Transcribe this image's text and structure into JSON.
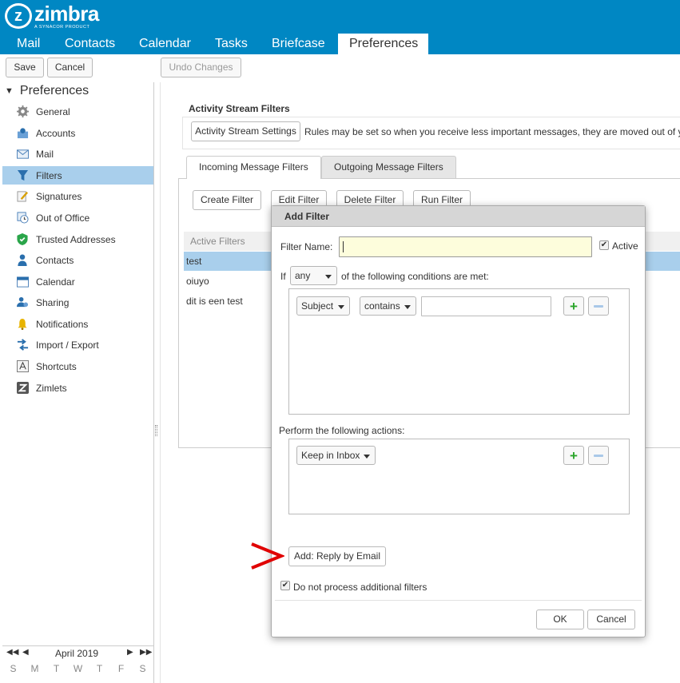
{
  "header": {
    "brand": "zimbra",
    "brand_sub": "A SYNACOR PRODUCT",
    "tabs": [
      "Mail",
      "Contacts",
      "Calendar",
      "Tasks",
      "Briefcase",
      "Preferences"
    ],
    "active_tab": "Preferences",
    "colors": {
      "topbar": "#0087c3",
      "selected": "#a9cfec"
    }
  },
  "toolbar": {
    "save": "Save",
    "cancel": "Cancel",
    "undo": "Undo Changes"
  },
  "sidebar": {
    "title": "Preferences",
    "items": [
      {
        "label": "General",
        "icon": "gear-icon"
      },
      {
        "label": "Accounts",
        "icon": "accounts-icon"
      },
      {
        "label": "Mail",
        "icon": "envelope-icon"
      },
      {
        "label": "Filters",
        "icon": "filter-icon",
        "selected": true
      },
      {
        "label": "Signatures",
        "icon": "signature-icon"
      },
      {
        "label": "Out of Office",
        "icon": "clock-icon"
      },
      {
        "label": "Trusted Addresses",
        "icon": "shield-icon"
      },
      {
        "label": "Contacts",
        "icon": "person-icon"
      },
      {
        "label": "Calendar",
        "icon": "calendar-icon"
      },
      {
        "label": "Sharing",
        "icon": "sharing-icon"
      },
      {
        "label": "Notifications",
        "icon": "bell-icon"
      },
      {
        "label": "Import / Export",
        "icon": "import-export-icon"
      },
      {
        "label": "Shortcuts",
        "icon": "keyboard-icon"
      },
      {
        "label": "Zimlets",
        "icon": "zimlet-icon"
      }
    ],
    "calendar": {
      "month": "April 2019",
      "days": [
        "S",
        "M",
        "T",
        "W",
        "T",
        "F",
        "S"
      ]
    }
  },
  "main": {
    "activity_stream": {
      "title": "Activity Stream Filters",
      "settings_button": "Activity Stream Settings",
      "description": "Rules may be set so when you receive less important messages, they are moved out of y"
    },
    "tabs": [
      "Incoming Message Filters",
      "Outgoing Message Filters"
    ],
    "actions": [
      "Create Filter",
      "Edit Filter",
      "Delete Filter",
      "Run Filter"
    ],
    "list_header": "Active Filters",
    "filters": [
      "test",
      "oiuyo",
      "dit is een test"
    ]
  },
  "dialog": {
    "title": "Add Filter",
    "filter_name_label": "Filter Name:",
    "filter_name_value": "",
    "active_label": "Active",
    "active_checked": true,
    "if_label": "If",
    "match_value": "any",
    "conditions_label": "of the following conditions are met:",
    "condition": {
      "field": "Subject",
      "operator": "contains",
      "value": ""
    },
    "actions_label": "Perform the following actions:",
    "action": "Keep in Inbox",
    "add_reply_button": "Add: Reply by Email",
    "stop_label": "Do not process additional filters",
    "stop_checked": true,
    "ok": "OK",
    "cancel": "Cancel"
  },
  "annotation": {
    "color": "#e00000"
  }
}
